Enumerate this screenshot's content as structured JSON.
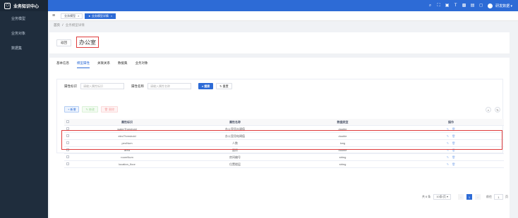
{
  "app": {
    "title": "业务知识中心",
    "logo_glyph": "⬡"
  },
  "sidebar": {
    "items": [
      {
        "label": "业务模型"
      },
      {
        "label": "业务对象"
      },
      {
        "label": "数据集"
      }
    ]
  },
  "topbar": {
    "icons": [
      {
        "name": "search-icon",
        "glyph": "⌕"
      },
      {
        "name": "fullscreen-icon",
        "glyph": "⛶"
      },
      {
        "name": "document-icon",
        "glyph": "▣"
      },
      {
        "name": "font-size-icon",
        "glyph": "T"
      },
      {
        "name": "image-icon",
        "glyph": "▩"
      },
      {
        "name": "layout-icon",
        "glyph": "▤"
      },
      {
        "name": "bell-icon",
        "glyph": "◻"
      }
    ],
    "user_name": "研发数据 ▾"
  },
  "tags": {
    "items": [
      {
        "label": "业务模型"
      },
      {
        "label": "业务模型详情"
      }
    ],
    "close_glyph": "×",
    "active_dot": "●",
    "menu_glyph": "≡"
  },
  "breadcrumb": {
    "home": "首页",
    "sep": "/",
    "current": "业务模型详情"
  },
  "header": {
    "back_label": "返回",
    "title": "办公室"
  },
  "tabs": [
    {
      "label": "基本信息"
    },
    {
      "label": "模型属性"
    },
    {
      "label": "关联关系"
    },
    {
      "label": "数据集"
    },
    {
      "label": "业务对象"
    }
  ],
  "search": {
    "field1_label": "属性标识",
    "field1_placeholder": "请输入属性标识",
    "field2_label": "属性名称",
    "field2_placeholder": "请输入属性名称",
    "search_label": "搜索",
    "reset_label": "重置",
    "search_glyph": "⌕",
    "reset_glyph": "↻"
  },
  "actions": {
    "add_label": "+ 新增",
    "edit_label": "✎ 修改",
    "delete_label": "🗑 删除",
    "search_toggle_glyph": "⌕",
    "refresh_glyph": "↻"
  },
  "table": {
    "columns": [
      "属性标识",
      "属性名称",
      "数据类型",
      "操作"
    ],
    "rows": [
      [
        "waterThreshold",
        "办公室用水阈值",
        "double"
      ],
      [
        "elecThreshold",
        "办公室用电阈值",
        "double"
      ],
      [
        "peoNum",
        "人数",
        "long"
      ],
      [
        "area",
        "面积",
        "double"
      ],
      [
        "roomNum",
        "房间编号",
        "string"
      ],
      [
        "location_floor",
        "位置楼层",
        "string"
      ]
    ],
    "op_edit_glyph": "✎",
    "op_delete_glyph": "🗑"
  },
  "pagination": {
    "total": "共 6 条",
    "page_size": "10条/页 ▾",
    "prev": "‹",
    "next": "›",
    "current": "1",
    "goto_label": "前往",
    "goto_value": "1",
    "page_suffix": "页"
  },
  "colors": {
    "primary": "#2d6bd6",
    "sidebar": "#1f2d3d",
    "highlight": "#e03c3c"
  }
}
